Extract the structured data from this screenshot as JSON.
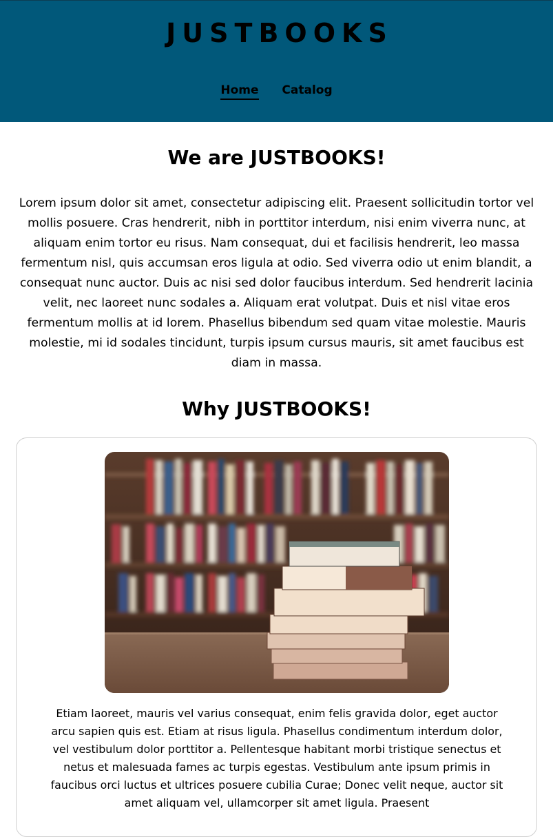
{
  "header": {
    "title": "JUSTBOOKS",
    "background": "#01587a",
    "nav": [
      {
        "label": "Home",
        "active": true
      },
      {
        "label": "Catalog",
        "active": false
      }
    ]
  },
  "about": {
    "heading": "We are JUSTBOOKS!",
    "text": "Lorem ipsum dolor sit amet, consectetur adipiscing elit. Praesent sollicitudin tortor vel mollis posuere. Cras hendrerit, nibh in porttitor interdum, nisi enim viverra nunc, at aliquam enim tortor eu risus. Nam consequat, dui et facilisis hendrerit, leo massa fermentum nisl, quis accumsan eros ligula at odio. Sed viverra odio ut enim blandit, a consequat nunc auctor. Duis ac nisi sed dolor faucibus interdum. Sed hendrerit lacinia velit, nec laoreet nunc sodales a. Aliquam erat volutpat. Duis et nisl vitae eros fermentum mollis at id lorem. Phasellus bibendum sed quam vitae molestie. Mauris molestie, mi id sodales tincidunt, turpis ipsum cursus mauris, sit amet faucibus est diam in massa."
  },
  "why": {
    "heading": "Why JUSTBOOKS!",
    "card": {
      "image": "stack-of-books-photo",
      "text": "Etiam laoreet, mauris vel varius consequat, enim felis gravida dolor, eget auctor arcu sapien quis est. Etiam at risus ligula. Phasellus condimentum interdum dolor, vel vestibulum dolor porttitor a. Pellentesque habitant morbi tristique senectus et netus et malesuada fames ac turpis egestas. Vestibulum ante ipsum primis in faucibus orci luctus et ultrices posuere cubilia Curae; Donec velit neque, auctor sit amet aliquam vel, ullamcorper sit amet ligula. Praesent"
    }
  }
}
